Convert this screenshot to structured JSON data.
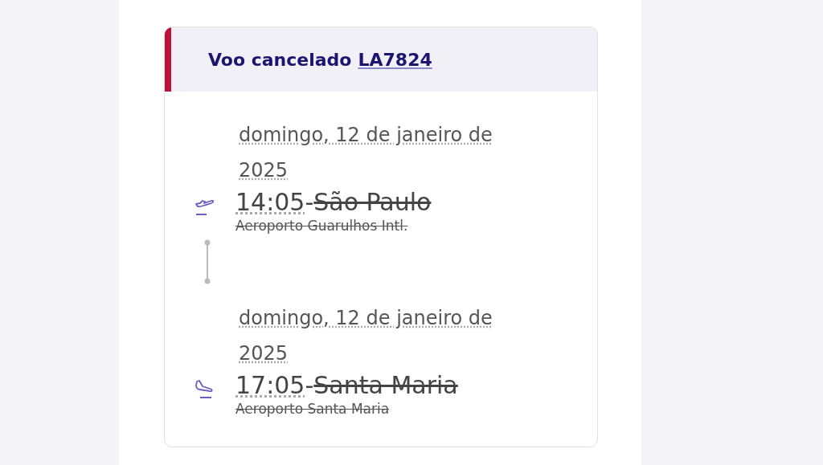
{
  "card": {
    "title": "Voo cancelado",
    "flight_number": "LA7824",
    "cancelled": true,
    "segments": [
      {
        "kind": "departure",
        "date": "domingo, 12 de janeiro de 2025",
        "time": "14:05",
        "separator": "-",
        "city": "São Paulo",
        "airport": "Aeroporto Guarulhos Intl."
      },
      {
        "kind": "arrival",
        "date": "domingo, 12 de janeiro de 2025",
        "time": "17:05",
        "separator": "-",
        "city": "Santa Maria",
        "airport": "Aeroporto Santa Maria"
      }
    ]
  }
}
